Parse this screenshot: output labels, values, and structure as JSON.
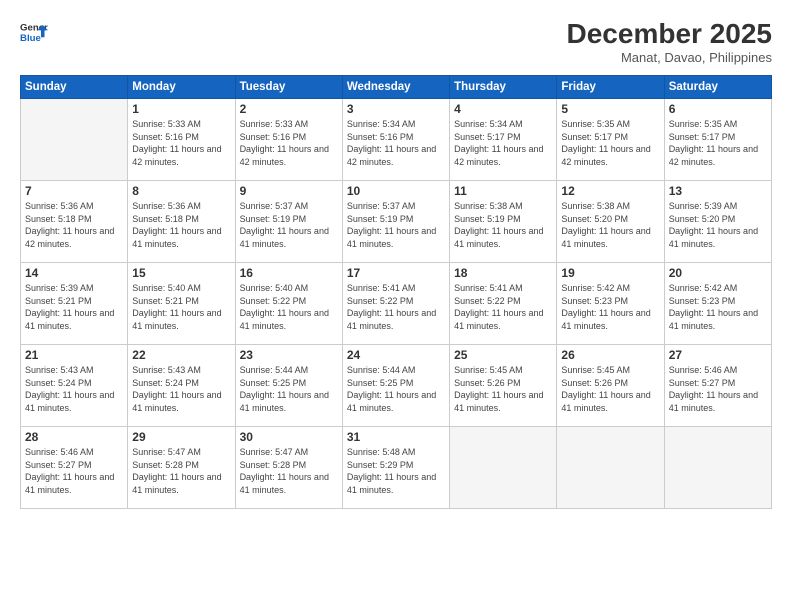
{
  "logo": {
    "line1": "General",
    "line2": "Blue"
  },
  "title": "December 2025",
  "location": "Manat, Davao, Philippines",
  "header": {
    "days": [
      "Sunday",
      "Monday",
      "Tuesday",
      "Wednesday",
      "Thursday",
      "Friday",
      "Saturday"
    ]
  },
  "weeks": [
    [
      {
        "day": "",
        "info": ""
      },
      {
        "day": "1",
        "info": "Sunrise: 5:33 AM\nSunset: 5:16 PM\nDaylight: 11 hours\nand 42 minutes."
      },
      {
        "day": "2",
        "info": "Sunrise: 5:33 AM\nSunset: 5:16 PM\nDaylight: 11 hours\nand 42 minutes."
      },
      {
        "day": "3",
        "info": "Sunrise: 5:34 AM\nSunset: 5:16 PM\nDaylight: 11 hours\nand 42 minutes."
      },
      {
        "day": "4",
        "info": "Sunrise: 5:34 AM\nSunset: 5:17 PM\nDaylight: 11 hours\nand 42 minutes."
      },
      {
        "day": "5",
        "info": "Sunrise: 5:35 AM\nSunset: 5:17 PM\nDaylight: 11 hours\nand 42 minutes."
      },
      {
        "day": "6",
        "info": "Sunrise: 5:35 AM\nSunset: 5:17 PM\nDaylight: 11 hours\nand 42 minutes."
      }
    ],
    [
      {
        "day": "7",
        "info": "Sunrise: 5:36 AM\nSunset: 5:18 PM\nDaylight: 11 hours\nand 42 minutes."
      },
      {
        "day": "8",
        "info": "Sunrise: 5:36 AM\nSunset: 5:18 PM\nDaylight: 11 hours\nand 41 minutes."
      },
      {
        "day": "9",
        "info": "Sunrise: 5:37 AM\nSunset: 5:19 PM\nDaylight: 11 hours\nand 41 minutes."
      },
      {
        "day": "10",
        "info": "Sunrise: 5:37 AM\nSunset: 5:19 PM\nDaylight: 11 hours\nand 41 minutes."
      },
      {
        "day": "11",
        "info": "Sunrise: 5:38 AM\nSunset: 5:19 PM\nDaylight: 11 hours\nand 41 minutes."
      },
      {
        "day": "12",
        "info": "Sunrise: 5:38 AM\nSunset: 5:20 PM\nDaylight: 11 hours\nand 41 minutes."
      },
      {
        "day": "13",
        "info": "Sunrise: 5:39 AM\nSunset: 5:20 PM\nDaylight: 11 hours\nand 41 minutes."
      }
    ],
    [
      {
        "day": "14",
        "info": "Sunrise: 5:39 AM\nSunset: 5:21 PM\nDaylight: 11 hours\nand 41 minutes."
      },
      {
        "day": "15",
        "info": "Sunrise: 5:40 AM\nSunset: 5:21 PM\nDaylight: 11 hours\nand 41 minutes."
      },
      {
        "day": "16",
        "info": "Sunrise: 5:40 AM\nSunset: 5:22 PM\nDaylight: 11 hours\nand 41 minutes."
      },
      {
        "day": "17",
        "info": "Sunrise: 5:41 AM\nSunset: 5:22 PM\nDaylight: 11 hours\nand 41 minutes."
      },
      {
        "day": "18",
        "info": "Sunrise: 5:41 AM\nSunset: 5:22 PM\nDaylight: 11 hours\nand 41 minutes."
      },
      {
        "day": "19",
        "info": "Sunrise: 5:42 AM\nSunset: 5:23 PM\nDaylight: 11 hours\nand 41 minutes."
      },
      {
        "day": "20",
        "info": "Sunrise: 5:42 AM\nSunset: 5:23 PM\nDaylight: 11 hours\nand 41 minutes."
      }
    ],
    [
      {
        "day": "21",
        "info": "Sunrise: 5:43 AM\nSunset: 5:24 PM\nDaylight: 11 hours\nand 41 minutes."
      },
      {
        "day": "22",
        "info": "Sunrise: 5:43 AM\nSunset: 5:24 PM\nDaylight: 11 hours\nand 41 minutes."
      },
      {
        "day": "23",
        "info": "Sunrise: 5:44 AM\nSunset: 5:25 PM\nDaylight: 11 hours\nand 41 minutes."
      },
      {
        "day": "24",
        "info": "Sunrise: 5:44 AM\nSunset: 5:25 PM\nDaylight: 11 hours\nand 41 minutes."
      },
      {
        "day": "25",
        "info": "Sunrise: 5:45 AM\nSunset: 5:26 PM\nDaylight: 11 hours\nand 41 minutes."
      },
      {
        "day": "26",
        "info": "Sunrise: 5:45 AM\nSunset: 5:26 PM\nDaylight: 11 hours\nand 41 minutes."
      },
      {
        "day": "27",
        "info": "Sunrise: 5:46 AM\nSunset: 5:27 PM\nDaylight: 11 hours\nand 41 minutes."
      }
    ],
    [
      {
        "day": "28",
        "info": "Sunrise: 5:46 AM\nSunset: 5:27 PM\nDaylight: 11 hours\nand 41 minutes."
      },
      {
        "day": "29",
        "info": "Sunrise: 5:47 AM\nSunset: 5:28 PM\nDaylight: 11 hours\nand 41 minutes."
      },
      {
        "day": "30",
        "info": "Sunrise: 5:47 AM\nSunset: 5:28 PM\nDaylight: 11 hours\nand 41 minutes."
      },
      {
        "day": "31",
        "info": "Sunrise: 5:48 AM\nSunset: 5:29 PM\nDaylight: 11 hours\nand 41 minutes."
      },
      {
        "day": "",
        "info": ""
      },
      {
        "day": "",
        "info": ""
      },
      {
        "day": "",
        "info": ""
      }
    ]
  ]
}
